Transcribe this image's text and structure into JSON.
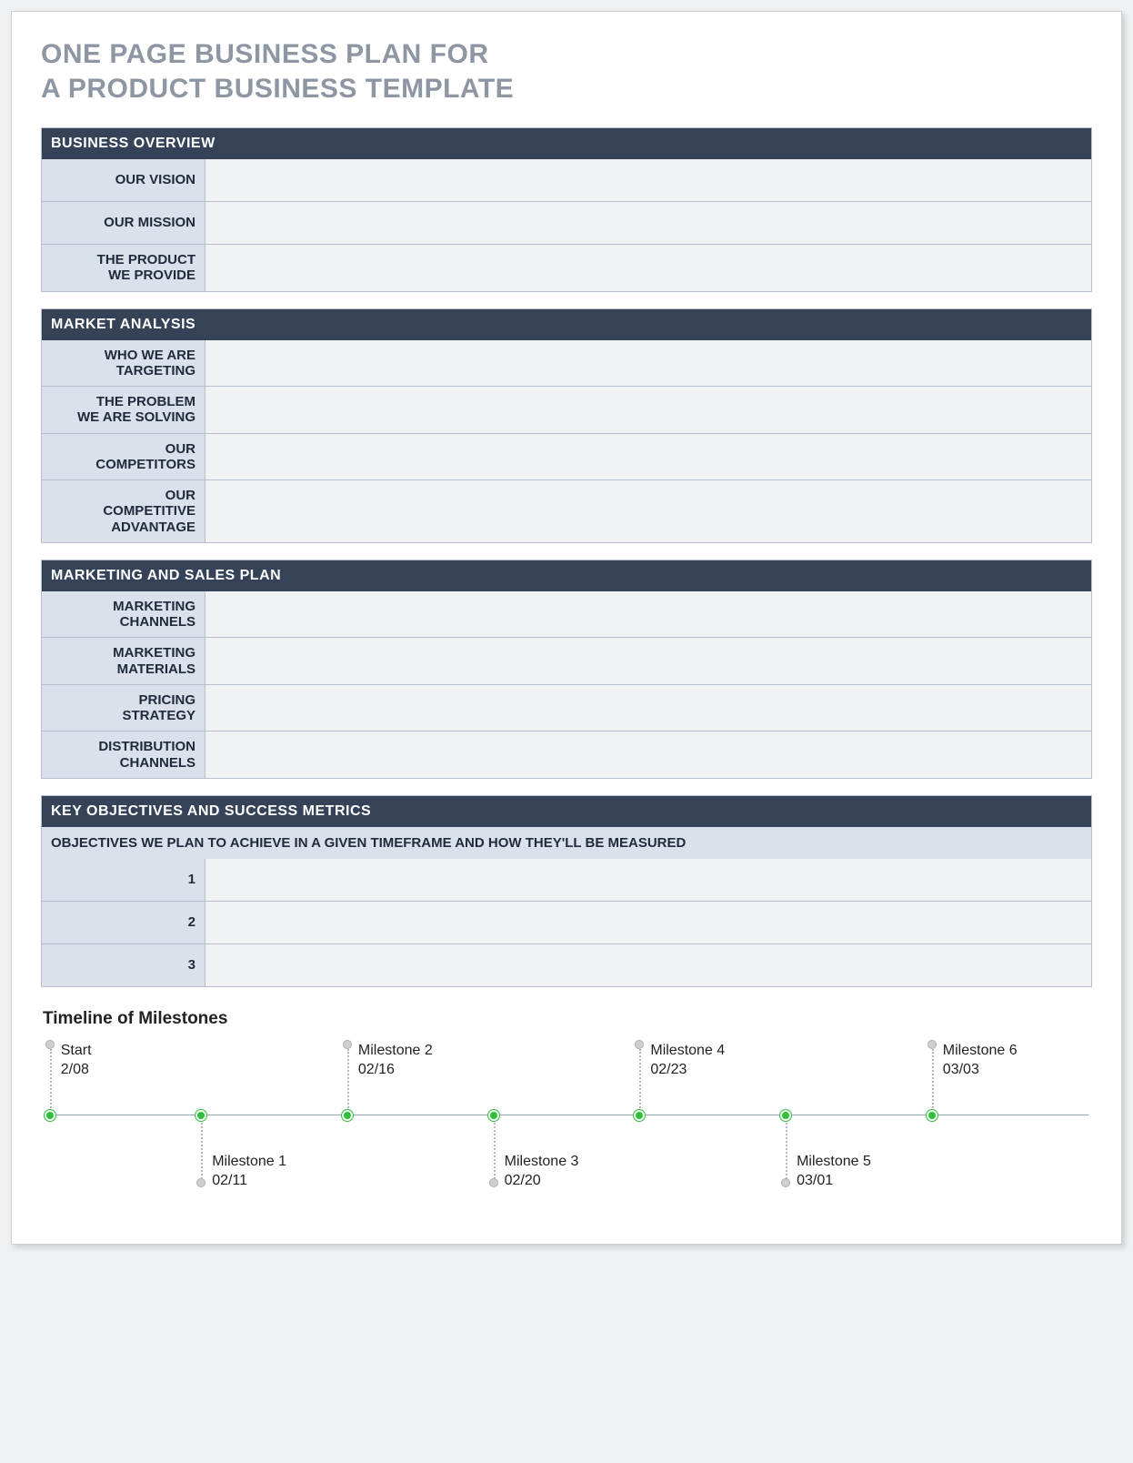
{
  "title_line1": "ONE PAGE BUSINESS PLAN FOR",
  "title_line2": "A PRODUCT BUSINESS TEMPLATE",
  "sections": {
    "overview": {
      "header": "BUSINESS OVERVIEW",
      "rows": [
        {
          "label": "OUR VISION",
          "value": ""
        },
        {
          "label": "OUR MISSION",
          "value": ""
        },
        {
          "label": "THE PRODUCT\nWE PROVIDE",
          "value": ""
        }
      ]
    },
    "market": {
      "header": "MARKET ANALYSIS",
      "rows": [
        {
          "label": "WHO WE ARE\nTARGETING",
          "value": ""
        },
        {
          "label": "THE PROBLEM\nWE ARE SOLVING",
          "value": ""
        },
        {
          "label": "OUR\nCOMPETITORS",
          "value": ""
        },
        {
          "label": "OUR\nCOMPETITIVE\nADVANTAGE",
          "value": ""
        }
      ]
    },
    "marketing": {
      "header": "MARKETING AND SALES PLAN",
      "rows": [
        {
          "label": "MARKETING\nCHANNELS",
          "value": ""
        },
        {
          "label": "MARKETING\nMATERIALS",
          "value": ""
        },
        {
          "label": "PRICING\nSTRATEGY",
          "value": ""
        },
        {
          "label": "DISTRIBUTION\nCHANNELS",
          "value": ""
        }
      ]
    },
    "objectives": {
      "header": "KEY OBJECTIVES AND SUCCESS METRICS",
      "sub_header": "OBJECTIVES WE PLAN TO ACHIEVE IN A GIVEN TIMEFRAME AND HOW THEY'LL BE MEASURED",
      "rows": [
        {
          "label": "1",
          "value": ""
        },
        {
          "label": "2",
          "value": ""
        },
        {
          "label": "3",
          "value": ""
        }
      ]
    }
  },
  "timeline": {
    "title": "Timeline of Milestones",
    "milestones": [
      {
        "name": "Start",
        "date": "2/08",
        "pos": 0.5,
        "side": "up"
      },
      {
        "name": "Milestone 1",
        "date": "02/11",
        "pos": 15,
        "side": "dn"
      },
      {
        "name": "Milestone 2",
        "date": "02/16",
        "pos": 29,
        "side": "up"
      },
      {
        "name": "Milestone 3",
        "date": "02/20",
        "pos": 43,
        "side": "dn"
      },
      {
        "name": "Milestone 4",
        "date": "02/23",
        "pos": 57,
        "side": "up"
      },
      {
        "name": "Milestone 5",
        "date": "03/01",
        "pos": 71,
        "side": "dn"
      },
      {
        "name": "Milestone 6",
        "date": "03/03",
        "pos": 85,
        "side": "up"
      }
    ]
  }
}
